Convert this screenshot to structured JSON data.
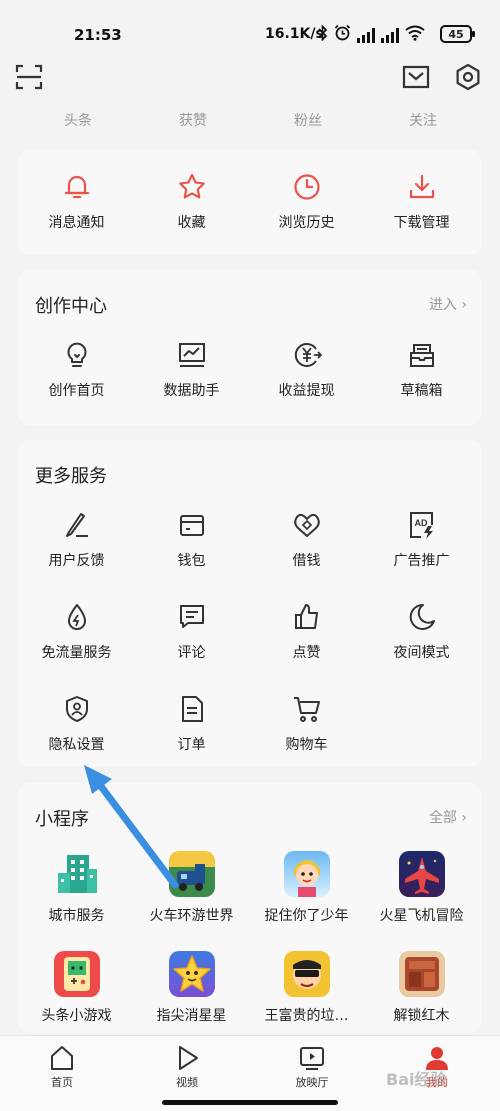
{
  "status": {
    "time": "21:53",
    "net_speed": "16.1K/s",
    "battery": "45"
  },
  "header": {
    "stats": [
      "头条",
      "获赞",
      "粉丝",
      "关注"
    ]
  },
  "quick": {
    "items": [
      {
        "label": "消息通知",
        "icon": "bell-icon"
      },
      {
        "label": "收藏",
        "icon": "star-icon"
      },
      {
        "label": "浏览历史",
        "icon": "clock-icon"
      },
      {
        "label": "下载管理",
        "icon": "download-icon"
      }
    ]
  },
  "creator": {
    "title": "创作中心",
    "more": "进入",
    "items": [
      {
        "label": "创作首页",
        "icon": "lightbulb-icon"
      },
      {
        "label": "数据助手",
        "icon": "chart-icon"
      },
      {
        "label": "收益提现",
        "icon": "yuan-withdraw-icon"
      },
      {
        "label": "草稿箱",
        "icon": "drafts-icon"
      }
    ]
  },
  "services": {
    "title": "更多服务",
    "items": [
      {
        "label": "用户反馈",
        "icon": "pen-icon"
      },
      {
        "label": "钱包",
        "icon": "wallet-icon"
      },
      {
        "label": "借钱",
        "icon": "loan-icon"
      },
      {
        "label": "广告推广",
        "icon": "ad-icon"
      },
      {
        "label": "免流量服务",
        "icon": "data-free-icon"
      },
      {
        "label": "评论",
        "icon": "comment-icon"
      },
      {
        "label": "点赞",
        "icon": "thumbs-up-icon"
      },
      {
        "label": "夜间模式",
        "icon": "moon-icon"
      },
      {
        "label": "隐私设置",
        "icon": "privacy-shield-icon"
      },
      {
        "label": "订单",
        "icon": "order-icon"
      },
      {
        "label": "购物车",
        "icon": "cart-icon"
      }
    ]
  },
  "mini": {
    "title": "小程序",
    "more": "全部",
    "apps": [
      {
        "label": "城市服务"
      },
      {
        "label": "火车环游世界"
      },
      {
        "label": "捉住你了少年"
      },
      {
        "label": "火星飞机冒险"
      },
      {
        "label": "头条小游戏"
      },
      {
        "label": "指尖消星星"
      },
      {
        "label": "王富贵的垃…"
      },
      {
        "label": "解锁红木"
      }
    ]
  },
  "nav": {
    "items": [
      {
        "label": "首页"
      },
      {
        "label": "视频"
      },
      {
        "label": "放映厅"
      },
      {
        "label": "我的"
      }
    ]
  },
  "colors": {
    "accent": "#e9534a",
    "icon": "#333333",
    "arrow": "#3a8fe0"
  },
  "watermark": "Bai经验"
}
